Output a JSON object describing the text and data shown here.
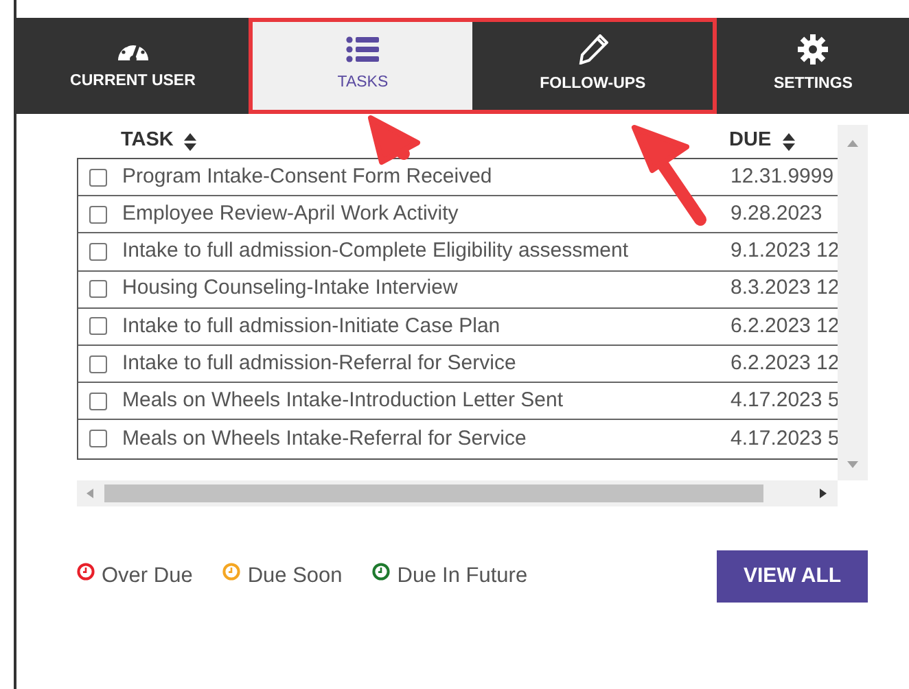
{
  "tabs": [
    {
      "label": "CURRENT USER",
      "selected": false,
      "highlighted": false
    },
    {
      "label": "TASKS",
      "selected": true,
      "highlighted": true
    },
    {
      "label": "FOLLOW-UPS",
      "selected": false,
      "highlighted": true
    },
    {
      "label": "SETTINGS",
      "selected": false,
      "highlighted": false
    }
  ],
  "table": {
    "columns": [
      "TASK",
      "DUE"
    ],
    "rows": [
      {
        "task": "Program Intake-Consent Form Received",
        "due": "12.31.9999",
        "checked": false
      },
      {
        "task": "Employee Review-April Work Activity",
        "due": "9.28.2023",
        "checked": false
      },
      {
        "task": "Intake to full admission-Complete Eligibility assessment",
        "due": "9.1.2023 12",
        "checked": false
      },
      {
        "task": "Housing Counseling-Intake Interview",
        "due": "8.3.2023 12",
        "checked": false
      },
      {
        "task": "Intake to full admission-Initiate Case Plan",
        "due": "6.2.2023 12",
        "checked": false
      },
      {
        "task": "Intake to full admission-Referral for Service",
        "due": "6.2.2023 12",
        "checked": false
      },
      {
        "task": "Meals on Wheels Intake-Introduction Letter Sent",
        "due": "4.17.2023 5",
        "checked": false
      },
      {
        "task": "Meals on Wheels Intake-Referral for Service",
        "due": "4.17.2023 5",
        "checked": false
      }
    ]
  },
  "legend": [
    {
      "label": "Over Due",
      "color": "#e8202a"
    },
    {
      "label": "Due Soon",
      "color": "#f4a623"
    },
    {
      "label": "Due In Future",
      "color": "#1e7a2e"
    }
  ],
  "button": "VIEW ALL"
}
